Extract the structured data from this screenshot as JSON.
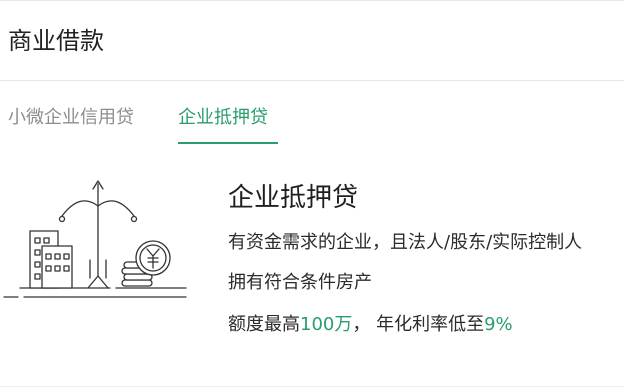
{
  "header": {
    "title": "商业借款"
  },
  "tabs": [
    {
      "label": "小微企业信用贷",
      "active": false
    },
    {
      "label": "企业抵押贷",
      "active": true
    }
  ],
  "product": {
    "title": "企业抵押贷",
    "requirement_line1": "有资金需求的企业，且法人/股东/实际控制人",
    "requirement_line2": "拥有符合条件房产",
    "limit_prefix": "额度最高",
    "limit_amount": "100万",
    "limit_separator": "，",
    "rate_prefix": " 年化利率低至",
    "rate_value": "9%"
  },
  "colors": {
    "accent": "#2a9d6c",
    "text_primary": "#222222",
    "text_muted": "#8d8d8d",
    "divider": "#e6e6e6"
  },
  "icons": [
    "building-icon",
    "balance-scale-icon",
    "yuan-coin-icon"
  ]
}
